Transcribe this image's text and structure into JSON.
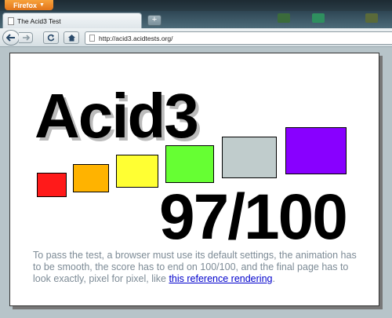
{
  "browser": {
    "menu_button_label": "Firefox",
    "tab_title": "The Acid3 Test",
    "new_tab_label": "+",
    "url": "http://acid3.acidtests.org/"
  },
  "page": {
    "title": "Acid3",
    "score": "97/100",
    "score_value": 97,
    "score_max": 100,
    "instructions_text": "To pass the test, a browser must use its default settings, the animation has to be smooth, the score has to end on 100/100, and the final page has to look exactly, pixel for pixel, like ",
    "reference_link": "this reference rendering",
    "instructions_end": ".",
    "boxes": [
      {
        "color": "#ff1a1a"
      },
      {
        "color": "#ffb300"
      },
      {
        "color": "#ffff33"
      },
      {
        "color": "#66ff33"
      },
      {
        "color": "#c0cccc"
      },
      {
        "color": "#8800ff"
      }
    ]
  },
  "icons": [
    "firefox-dropdown-icon",
    "back-arrow-icon",
    "forward-arrow-icon",
    "reload-icon",
    "home-icon",
    "page-favicon-icon"
  ]
}
